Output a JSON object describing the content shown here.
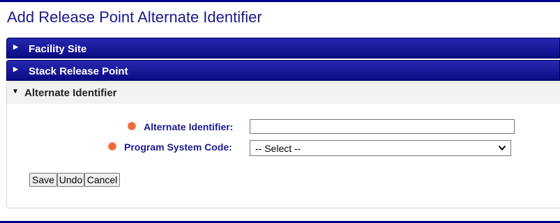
{
  "page": {
    "title": "Add Release Point Alternate Identifier"
  },
  "panels": [
    {
      "label": "Facility Site"
    },
    {
      "label": "Stack Release Point"
    }
  ],
  "alt_section": {
    "label": "Alternate Identifier",
    "fields": {
      "alternate_identifier": {
        "label": "Alternate Identifier:",
        "value": ""
      },
      "program_system_code": {
        "label": "Program System Code:",
        "selected": "-- Select --"
      }
    }
  },
  "buttons": {
    "save": "Save",
    "undo": "Undo",
    "cancel": "Cancel"
  },
  "colors": {
    "brand_navy": "#0a0a84",
    "required_marker": "#f06a3c",
    "title": "#1a1a8c"
  }
}
